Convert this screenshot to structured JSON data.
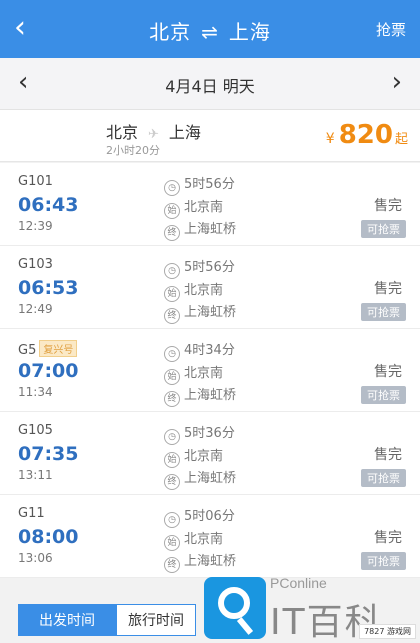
{
  "header": {
    "from": "北京",
    "swap_icon": "⇌",
    "to": "上海",
    "grab_label": "抢票"
  },
  "date_bar": {
    "date_text": "4月4日 明天"
  },
  "summary": {
    "from": "北京",
    "to": "上海",
    "duration": "2小时20分",
    "currency": "¥",
    "price": "820",
    "price_suffix": "起"
  },
  "trains": [
    {
      "number": "G101",
      "badge": "",
      "depart_time": "06:43",
      "arrive_time": "12:39",
      "duration": "5时56分",
      "from_station": "北京南",
      "to_station": "上海虹桥",
      "status": "售完",
      "grab": "可抢票"
    },
    {
      "number": "G103",
      "badge": "",
      "depart_time": "06:53",
      "arrive_time": "12:49",
      "duration": "5时56分",
      "from_station": "北京南",
      "to_station": "上海虹桥",
      "status": "售完",
      "grab": "可抢票"
    },
    {
      "number": "G5",
      "badge": "复兴号",
      "depart_time": "07:00",
      "arrive_time": "11:34",
      "duration": "4时34分",
      "from_station": "北京南",
      "to_station": "上海虹桥",
      "status": "售完",
      "grab": "可抢票"
    },
    {
      "number": "G105",
      "badge": "",
      "depart_time": "07:35",
      "arrive_time": "13:11",
      "duration": "5时36分",
      "from_station": "北京南",
      "to_station": "上海虹桥",
      "status": "售完",
      "grab": "可抢票"
    },
    {
      "number": "G11",
      "badge": "",
      "depart_time": "08:00",
      "arrive_time": "13:06",
      "duration": "5时06分",
      "from_station": "北京南",
      "to_station": "上海虹桥",
      "status": "售完",
      "grab": "可抢票"
    }
  ],
  "icons": {
    "clock": "clock-icon",
    "depart": "始",
    "arrive": "终"
  },
  "tabs": {
    "active": "出发时间",
    "inactive": "旅行时间"
  },
  "watermark": {
    "brand": "PConline",
    "big": "IT百科",
    "corner": "7827 游戏网"
  },
  "colors": {
    "accent": "#3a8ee6",
    "price": "#f08b12",
    "time": "#2f6fbf"
  }
}
